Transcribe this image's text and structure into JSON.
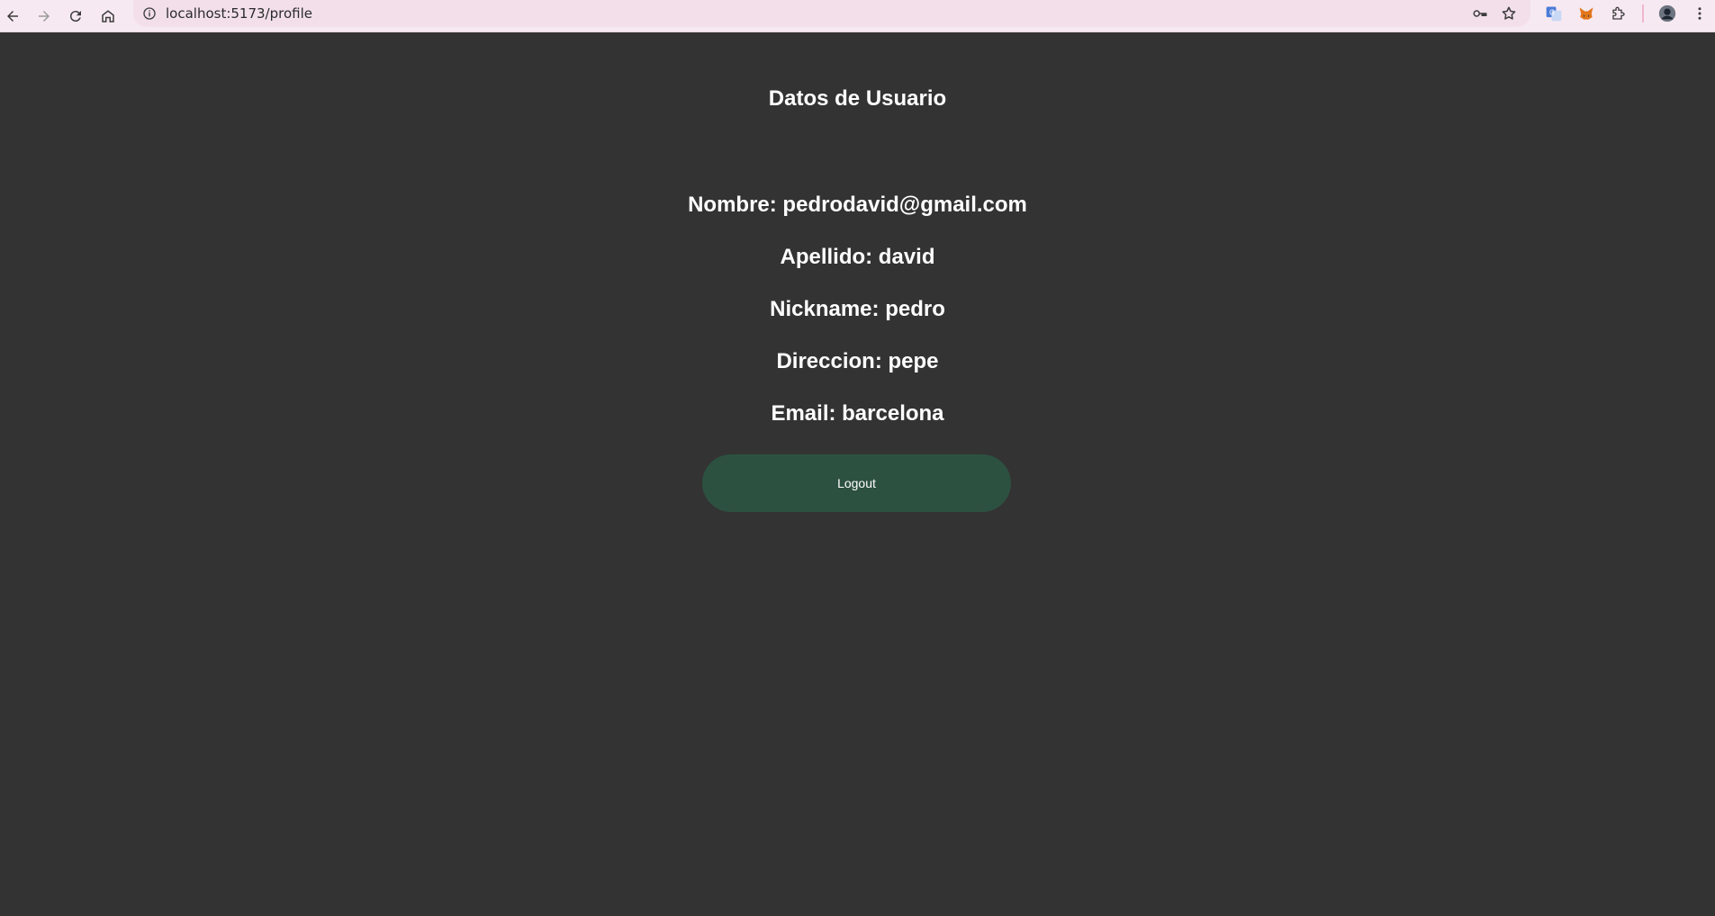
{
  "browser": {
    "url": "localhost:5173/profile",
    "icons": {
      "back": "back-arrow-icon",
      "forward": "forward-arrow-icon",
      "reload": "reload-icon",
      "home": "home-icon",
      "site_info": "info-icon",
      "password": "key-icon",
      "bookmark": "star-icon",
      "translate": "translate-icon",
      "metamask": "fox-extension-icon",
      "extensions": "puzzle-icon",
      "profile": "avatar-icon",
      "menu": "kebab-menu-icon"
    }
  },
  "profile": {
    "title": "Datos de Usuario",
    "nombre": "Nombre: pedrodavid@gmail.com",
    "apellido": "Apellido: david",
    "nickname": "Nickname: pedro",
    "direccion": "Direccion: pepe",
    "email": "Email: barcelona",
    "logout_label": "Logout"
  },
  "colors": {
    "background": "#333333",
    "button": "#2d5141",
    "text": "#ffffff"
  }
}
